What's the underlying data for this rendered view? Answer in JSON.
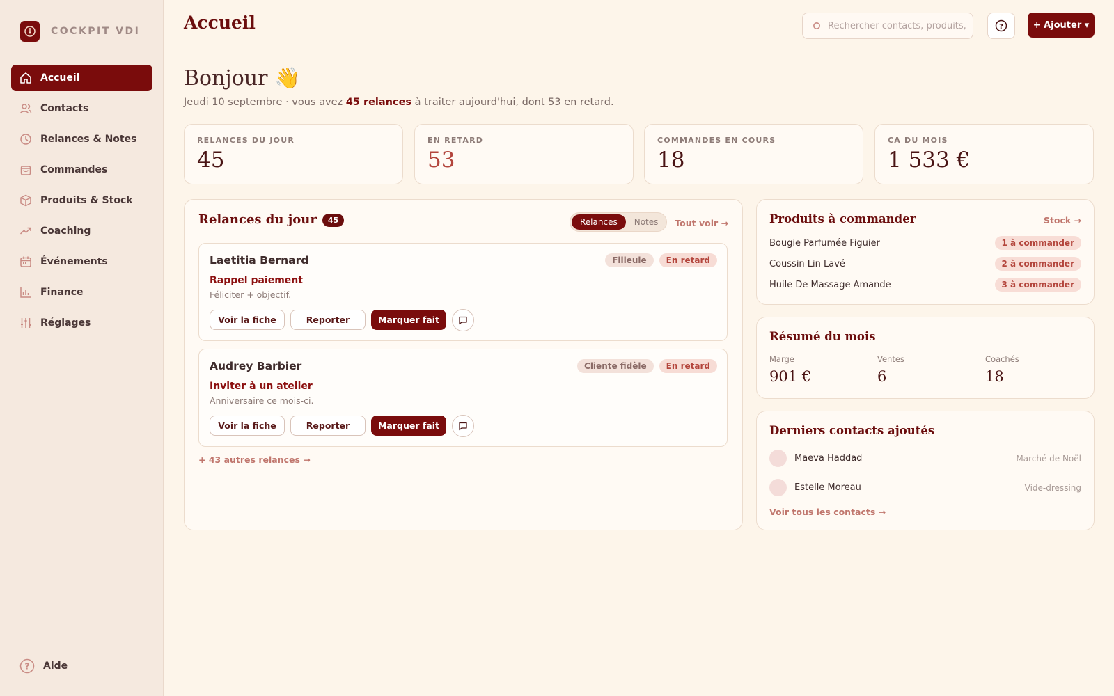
{
  "brand": {
    "name": "COCKPIT VDI"
  },
  "sidebar": {
    "items": [
      {
        "label": "Accueil",
        "icon": "home-icon",
        "active": true
      },
      {
        "label": "Contacts",
        "icon": "users-icon"
      },
      {
        "label": "Relances & Notes",
        "icon": "clock-icon"
      },
      {
        "label": "Commandes",
        "icon": "bag-icon"
      },
      {
        "label": "Produits & Stock",
        "icon": "box-icon"
      },
      {
        "label": "Coaching",
        "icon": "trend-icon"
      },
      {
        "label": "Événements",
        "icon": "calendar-icon"
      },
      {
        "label": "Finance",
        "icon": "chart-icon"
      },
      {
        "label": "Réglages",
        "icon": "sliders-icon"
      }
    ],
    "help_label": "Aide"
  },
  "header": {
    "title": "Accueil",
    "search_placeholder": "Rechercher contacts, produits,",
    "add_label": "+ Ajouter ▾"
  },
  "greeting": {
    "title": "Bonjour 👋",
    "date": "Jeudi 10 septembre · vous avez ",
    "relances": "45 relances",
    "rest": " à traiter aujourd'hui, dont 53 en retard."
  },
  "stats": [
    {
      "label": "RELANCES DU JOUR",
      "value": "45"
    },
    {
      "label": "EN RETARD",
      "value": "53"
    },
    {
      "label": "COMMANDES EN COURS",
      "value": "18"
    },
    {
      "label": "CA DU MOIS",
      "value": "1 533 €"
    }
  ],
  "relances": {
    "title": "Relances du jour",
    "count": "45",
    "toggle": [
      "Relances",
      "Notes"
    ],
    "see_all": "Tout voir →",
    "tasks": [
      {
        "name": "Laetitia Bernard",
        "tags": [
          "Filleule",
          "En retard"
        ],
        "action": "Rappel paiement",
        "note": "Féliciter + objectif."
      },
      {
        "name": "Audrey Barbier",
        "tags": [
          "Cliente fidèle",
          "En retard"
        ],
        "action": "Inviter à un atelier",
        "note": "Anniversaire ce mois-ci."
      }
    ],
    "buttons": {
      "view": "Voir la fiche",
      "postpone": "Reporter",
      "done": "Marquer fait"
    },
    "more": "+ 43 autres relances →"
  },
  "produits": {
    "title": "Produits à commander",
    "link": "Stock →",
    "items": [
      {
        "name": "Bougie Parfumée Figuier",
        "qty": "1 à commander"
      },
      {
        "name": "Coussin Lin Lavé",
        "qty": "2 à commander"
      },
      {
        "name": "Huile De Massage Amande",
        "qty": "3 à commander"
      }
    ]
  },
  "resume": {
    "title": "Résumé du mois",
    "metrics": [
      {
        "label": "Marge",
        "value": "901 €"
      },
      {
        "label": "Ventes",
        "value": "6"
      },
      {
        "label": "Coachés",
        "value": "18"
      }
    ]
  },
  "contacts": {
    "title": "Derniers contacts ajoutés",
    "items": [
      {
        "name": "Maeva Haddad",
        "source": "Marché de Noël"
      },
      {
        "name": "Estelle Moreau",
        "source": "Vide-dressing"
      }
    ],
    "link": "Voir tous les contacts →"
  },
  "colors": {
    "accent": "#7a0c0c",
    "background": "#fdf5ea",
    "sidebar": "#f5e9df",
    "late": "#b3453c"
  }
}
